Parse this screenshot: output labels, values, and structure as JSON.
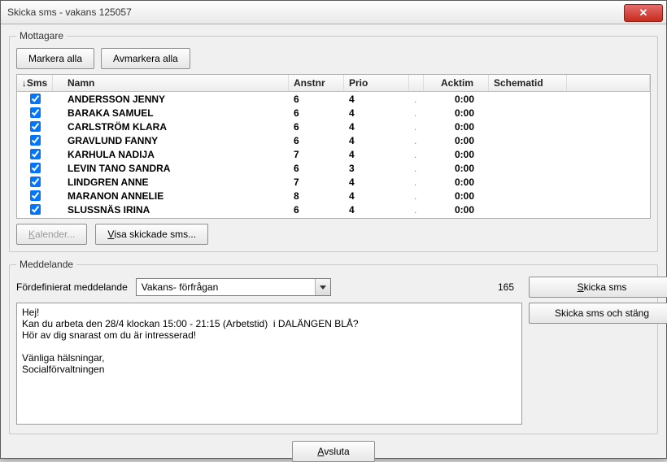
{
  "window": {
    "title": "Skicka sms - vakans 125057"
  },
  "recipients": {
    "legend": "Mottagare",
    "select_all": "Markera alla",
    "deselect_all": "Avmarkera alla",
    "columns": {
      "sms": "Sms",
      "name": "Namn",
      "anstnr": "Anstnr",
      "prio": "Prio",
      "gap": "",
      "acktim": "Acktim",
      "schematid": "Schematid"
    },
    "rows": [
      {
        "checked": true,
        "name": "ANDERSSON JENNY",
        "anstnr": "6",
        "prio": "4",
        "acktim": "0:00",
        "schematid": ""
      },
      {
        "checked": true,
        "name": "BARAKA SAMUEL",
        "anstnr": "6",
        "prio": "4",
        "acktim": "0:00",
        "schematid": ""
      },
      {
        "checked": true,
        "name": "CARLSTRÖM KLARA",
        "anstnr": "6",
        "prio": "4",
        "acktim": "0:00",
        "schematid": ""
      },
      {
        "checked": true,
        "name": "GRAVLUND FANNY",
        "anstnr": "6",
        "prio": "4",
        "acktim": "0:00",
        "schematid": ""
      },
      {
        "checked": true,
        "name": "KARHULA NADIJA",
        "anstnr": "7",
        "prio": "4",
        "acktim": "0:00",
        "schematid": ""
      },
      {
        "checked": true,
        "name": "LEVIN TANO SANDRA",
        "anstnr": "6",
        "prio": "3",
        "acktim": "0:00",
        "schematid": ""
      },
      {
        "checked": true,
        "name": "LINDGREN ANNE",
        "anstnr": "7",
        "prio": "4",
        "acktim": "0:00",
        "schematid": ""
      },
      {
        "checked": true,
        "name": "MARANON ANNELIE",
        "anstnr": "8",
        "prio": "4",
        "acktim": "0:00",
        "schematid": ""
      },
      {
        "checked": true,
        "name": "SLUSSNÄS IRINA",
        "anstnr": "6",
        "prio": "4",
        "acktim": "0:00",
        "schematid": ""
      }
    ],
    "calendar_btn": "Kalender...",
    "show_sent_btn": "Visa skickade sms..."
  },
  "message": {
    "legend": "Meddelande",
    "predef_label": "Fördefinierat meddelande",
    "predef_value": "Vakans- förfrågan",
    "char_count": "165",
    "body": "Hej!\nKan du arbeta den 28/4 klockan 15:00 - 21:15 (Arbetstid)  i DALÄNGEN BLÅ?\nHör av dig snarast om du är intresserad!\n\nVänliga hälsningar,\nSocialförvaltningen",
    "send_btn": "Skicka sms",
    "send_close_btn": "Skicka sms och stäng"
  },
  "footer": {
    "close_btn": "Avsluta"
  }
}
